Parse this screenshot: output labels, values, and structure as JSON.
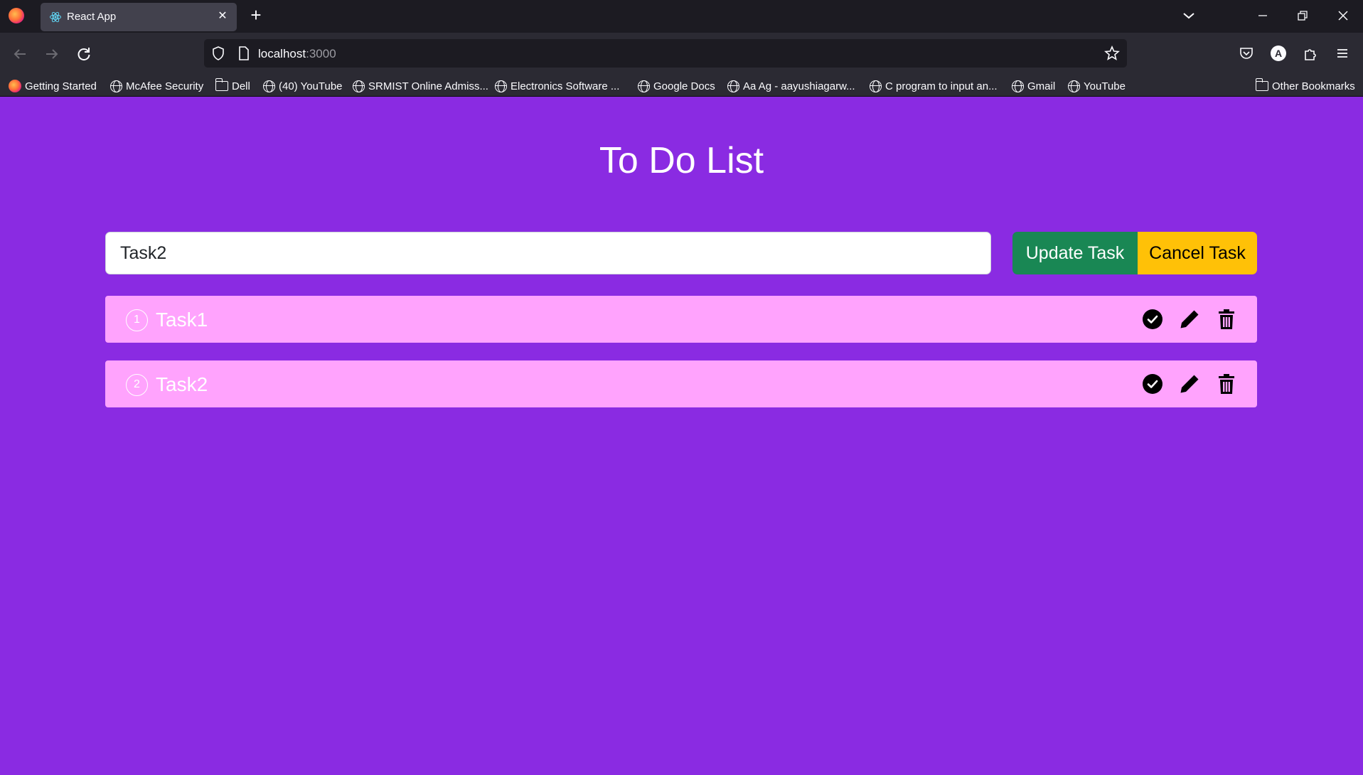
{
  "browser": {
    "tab_title": "React App",
    "url_host": "localhost",
    "url_port": ":3000",
    "bookmarks": [
      {
        "label": "Getting Started",
        "icon": "firefox-icon"
      },
      {
        "label": "McAfee Security",
        "icon": "globe-icon"
      },
      {
        "label": "Dell",
        "icon": "folder-icon"
      },
      {
        "label": "(40) YouTube",
        "icon": "globe-icon"
      },
      {
        "label": "SRMIST Online Admiss...",
        "icon": "globe-icon"
      },
      {
        "label": "Electronics Software ...",
        "icon": "globe-icon"
      },
      {
        "label": "Google Docs",
        "icon": "globe-icon"
      },
      {
        "label": "Aa Ag - aayushiagarw...",
        "icon": "globe-icon"
      },
      {
        "label": "C program to input an...",
        "icon": "globe-icon"
      },
      {
        "label": "Gmail",
        "icon": "globe-icon"
      },
      {
        "label": "YouTube",
        "icon": "globe-icon"
      }
    ],
    "other_bookmarks": "Other Bookmarks",
    "account_initial": "A"
  },
  "app": {
    "title": "To Do List",
    "input_value": "Task2",
    "update_label": "Update Task",
    "cancel_label": "Cancel Task",
    "tasks": [
      {
        "num": "1",
        "text": "Task1"
      },
      {
        "num": "2",
        "text": "Task2"
      }
    ]
  },
  "colors": {
    "page_bg": "#8a2be2",
    "task_bg": "#ffa3fd",
    "update_bg": "#198754",
    "cancel_bg": "#ffc107"
  }
}
